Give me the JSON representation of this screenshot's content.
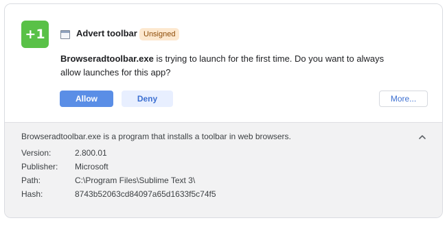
{
  "app": {
    "icon_text": "+1",
    "name": "Advert toolbar",
    "badge": "Unsigned",
    "colors": {
      "icon_bg": "#59c147",
      "badge_bg": "#fde8cf",
      "accent": "#5a8ee6"
    }
  },
  "message": {
    "exe": "Browseradtoolbar.exe",
    "text": " is trying to launch for the first time. Do you want to always allow launches for this app?"
  },
  "buttons": {
    "allow": "Allow",
    "deny": "Deny",
    "more": "More..."
  },
  "details": {
    "description": "Browseradtoolbar.exe is a program that installs a toolbar in web browsers.",
    "rows": [
      {
        "label": "Version:",
        "value": "2.800.01"
      },
      {
        "label": "Publisher:",
        "value": "Microsoft"
      },
      {
        "label": "Path:",
        "value": "C:\\Program Files\\Sublime Text 3\\"
      },
      {
        "label": "Hash:",
        "value": "8743b52063cd84097a65d1633f5c74f5"
      }
    ]
  },
  "icons": {
    "app": "app-icon",
    "window": "window-icon",
    "collapse": "chevron-up-icon"
  }
}
